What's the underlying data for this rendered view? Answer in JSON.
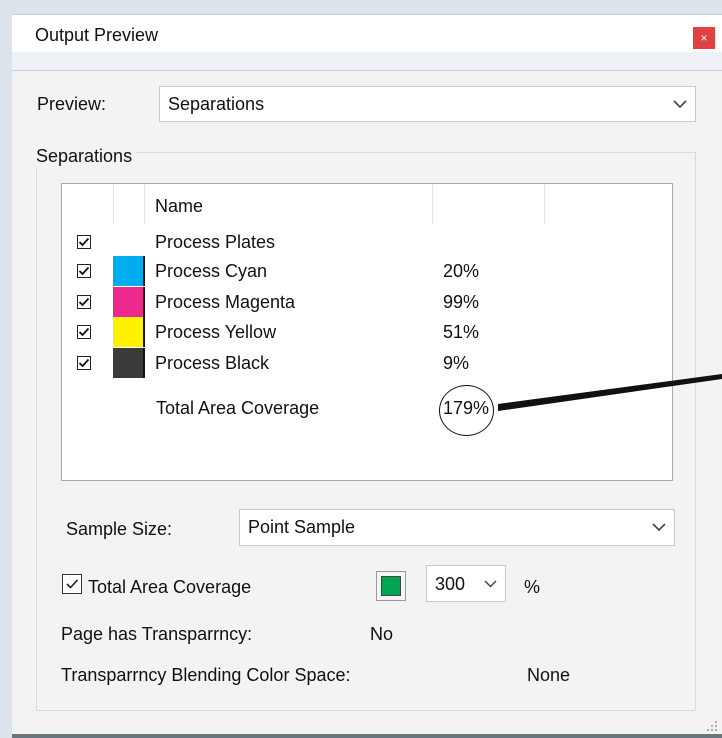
{
  "window": {
    "title": "Output Preview",
    "close_glyph": "×"
  },
  "preview": {
    "label": "Preview:",
    "value": "Separations"
  },
  "separations": {
    "group_label": "Separations",
    "header_name": "Name",
    "rows": [
      {
        "name": "Process Plates",
        "value": "",
        "checked": true,
        "color": ""
      },
      {
        "name": "Process Cyan",
        "value": "20%",
        "checked": true,
        "color": "#00aeef"
      },
      {
        "name": "Process Magenta",
        "value": "99%",
        "checked": true,
        "color": "#ec2a8d"
      },
      {
        "name": "Process Yellow",
        "value": "51%",
        "checked": true,
        "color": "#fff200"
      },
      {
        "name": "Process Black",
        "value": "9%",
        "checked": true,
        "color": "#3a3a3a"
      }
    ],
    "total_label": "Total Area Coverage",
    "total_value": "179%"
  },
  "sample_size": {
    "label": "Sample Size:",
    "value": "Point Sample"
  },
  "tac": {
    "label": "Total Area Coverage",
    "checked": true,
    "color": "#00a651",
    "value": "300",
    "unit": "%"
  },
  "transparency": {
    "label": "Page has Transparrncy:",
    "value": "No"
  },
  "blending": {
    "label": "Transparrncy Blending Color Space:",
    "value": "None"
  }
}
